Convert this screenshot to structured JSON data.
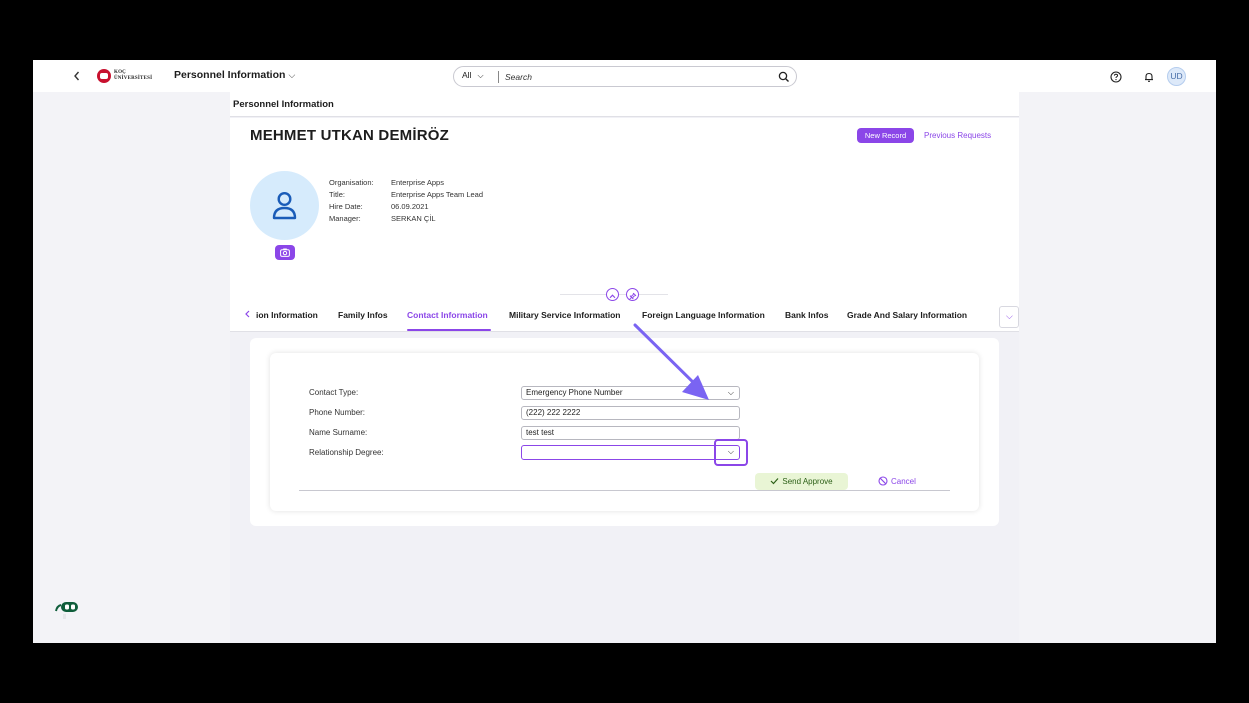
{
  "shell": {
    "logo_line1": "KOÇ",
    "logo_line2": "ÜNİVERSİTESİ",
    "app_title": "Personnel Information",
    "search_scope": "All",
    "search_placeholder": "Search",
    "avatar_initials": "UD"
  },
  "page": {
    "title": "Personnel Information"
  },
  "header": {
    "name": "MEHMET UTKAN DEMİRÖZ",
    "new_record_label": "New Record",
    "previous_requests_label": "Previous Requests",
    "info": [
      {
        "label": "Organisation:",
        "value": "Enterprise Apps"
      },
      {
        "label": "Title:",
        "value": "Enterprise Apps Team Lead"
      },
      {
        "label": "Hire Date:",
        "value": "06.09.2021"
      },
      {
        "label": "Manager:",
        "value": "SERKAN ÇİL"
      }
    ]
  },
  "tabs": [
    {
      "label": "ion Information",
      "active": false
    },
    {
      "label": "Family Infos",
      "active": false
    },
    {
      "label": "Contact Information",
      "active": true
    },
    {
      "label": "Military Service Information",
      "active": false
    },
    {
      "label": "Foreign Language Information",
      "active": false
    },
    {
      "label": "Bank Infos",
      "active": false
    },
    {
      "label": "Grade And Salary Information",
      "active": false
    }
  ],
  "form": {
    "contact_type": {
      "label": "Contact Type:",
      "value": "Emergency Phone Number"
    },
    "phone_number": {
      "label": "Phone Number:",
      "value": "(222) 222 2222"
    },
    "name_surname": {
      "label": "Name Surname:",
      "value": "test test"
    },
    "relationship_degree": {
      "label": "Relationship Degree:",
      "value": ""
    },
    "send_approve_label": "Send Approve",
    "cancel_label": "Cancel"
  },
  "colors": {
    "accent": "#8b46e8",
    "approve_bg": "#e9f5d5",
    "approve_text": "#2b5f16",
    "avatar_bg": "#d6ebfc",
    "arrow": "#7a64f2"
  }
}
